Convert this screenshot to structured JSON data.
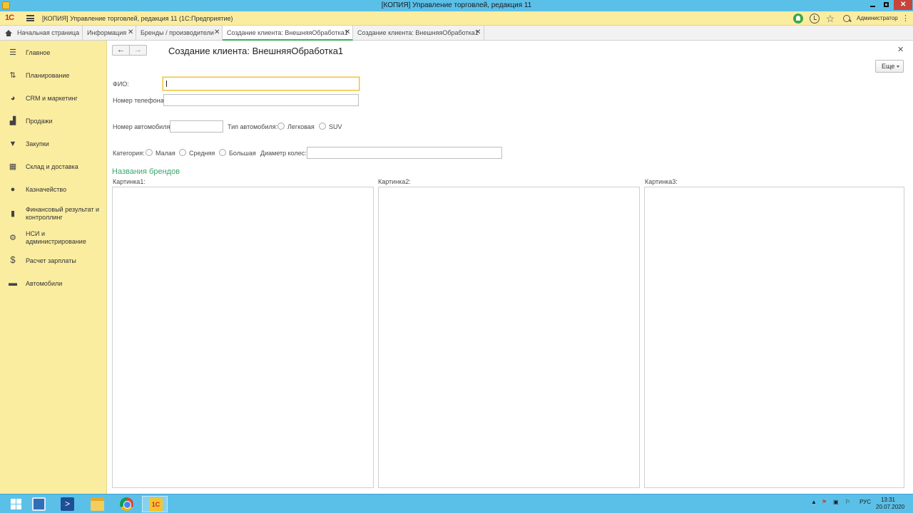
{
  "window": {
    "title": "[КОПИЯ] Управление торговлей, редакция 11"
  },
  "topbar": {
    "app_title": "[КОПИЯ] Управление торговлей, редакция 11  (1С:Предприятие)",
    "user": "Администратор",
    "logo_text": "1С"
  },
  "tabs": [
    {
      "label": "Начальная страница"
    },
    {
      "label": "Информация"
    },
    {
      "label": "Бренды / производители"
    },
    {
      "label": "Создание клиента: ВнешняяОбработка1"
    },
    {
      "label": "Создание клиента: ВнешняяОбработка1"
    }
  ],
  "sidebar": {
    "items": [
      {
        "label": "Главное",
        "icon": "menu-icon"
      },
      {
        "label": "Планирование",
        "icon": "planning-icon"
      },
      {
        "label": "CRM и маркетинг",
        "icon": "pie-chart-icon"
      },
      {
        "label": "Продажи",
        "icon": "bag-icon"
      },
      {
        "label": "Закупки",
        "icon": "cart-icon"
      },
      {
        "label": "Склад и доставка",
        "icon": "grid-icon"
      },
      {
        "label": "Казначейство",
        "icon": "coin-icon"
      },
      {
        "label": "Финансовый результат и контроллинг",
        "icon": "bar-chart-icon"
      },
      {
        "label": "НСИ и администрирование",
        "icon": "gear-icon"
      },
      {
        "label": "Расчет зарплаты",
        "icon": "money-bag-icon"
      },
      {
        "label": "Автомобили",
        "icon": "car-icon"
      }
    ]
  },
  "form": {
    "title": "Создание клиента: ВнешняяОбработка1",
    "more_label": "Еще",
    "fio_label": "ФИО:",
    "fio_value": "",
    "phone_label": "Номер телефона:",
    "phone_value": "",
    "car_number_label": "Номер автомобиля:",
    "car_number_value": "",
    "car_type_label": "Тип автомобиля:",
    "car_type_options": [
      "Легковая",
      "SUV"
    ],
    "category_label": "Категория:",
    "category_options": [
      "Малая",
      "Средняя",
      "Большая"
    ],
    "wheel_diameter_label": "Диаметр колес:",
    "wheel_diameter_value": "",
    "brands_section_title": "Названия брендов",
    "pictures": [
      "Картинка1:",
      "Картинка2:",
      "Картинка3:"
    ]
  },
  "taskbar": {
    "language": "РУС",
    "time": "13:31",
    "date": "20.07.2020"
  },
  "colors": {
    "titlebar": "#5bc0e8",
    "sidebar": "#fbeda0",
    "accent_green": "#3aa66b",
    "focus_yellow": "#f1c23b"
  }
}
